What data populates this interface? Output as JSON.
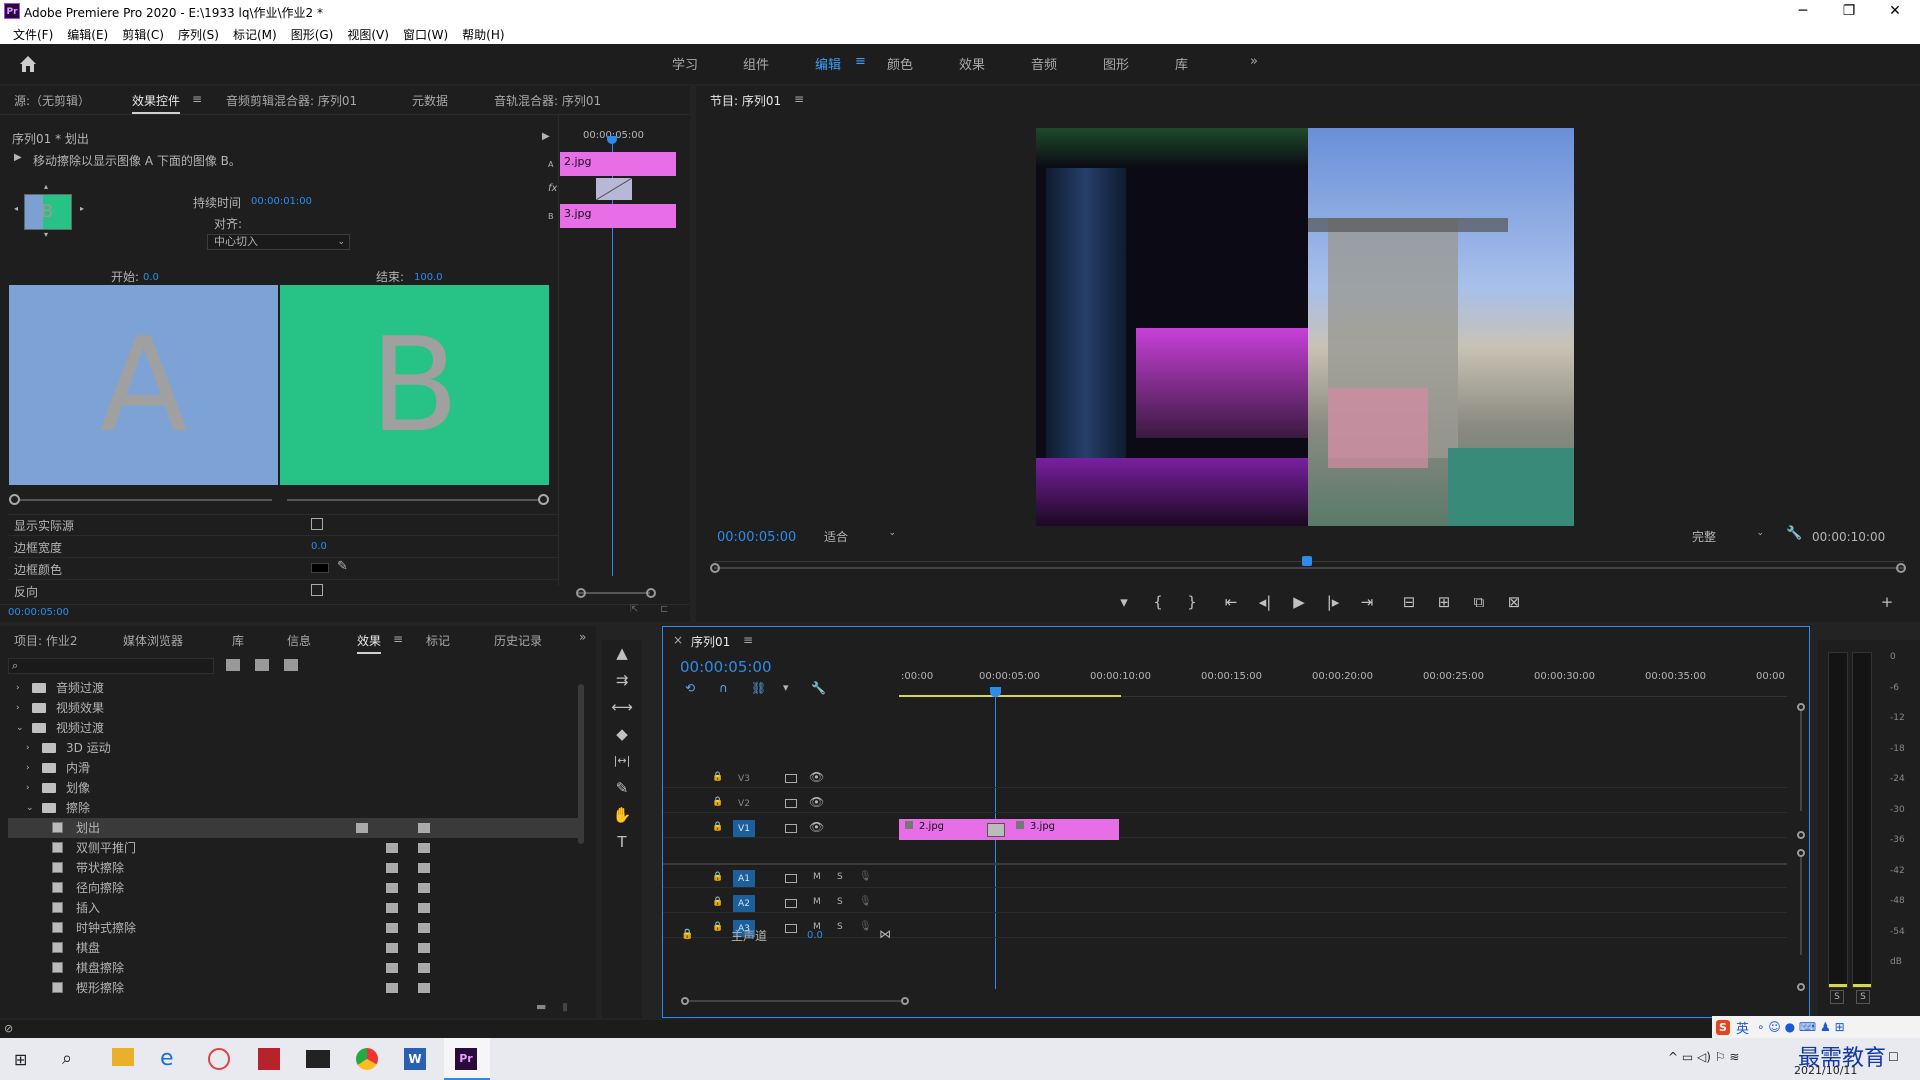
{
  "window": {
    "title": "Adobe Premiere Pro 2020 - E:\\1933 lq\\作业\\作业2 *",
    "app_icon": "Pr",
    "minimize": "─",
    "restore": "❐",
    "close": "✕"
  },
  "menu": [
    "文件(F)",
    "编辑(E)",
    "剪辑(C)",
    "序列(S)",
    "标记(M)",
    "图形(G)",
    "视图(V)",
    "窗口(W)",
    "帮助(H)"
  ],
  "workspaces": {
    "items": [
      "学习",
      "组件",
      "编辑",
      "颜色",
      "效果",
      "音频",
      "图形",
      "库"
    ],
    "active": "编辑",
    "more": "»",
    "menu_icon": "≡"
  },
  "source_panel": {
    "tabs": [
      "源:（无剪辑）",
      "效果控件",
      "音频剪辑混合器: 序列01",
      "元数据",
      "音轨混合器: 序列01"
    ],
    "active_menu": "≡"
  },
  "effect_controls": {
    "clip": "序列01 * 划出",
    "desc": "移动擦除以显示图像 A 下面的图像 B。",
    "duration_label": "持续时间",
    "duration": "00:00:01:00",
    "align_label": "对齐:",
    "align": "中心切入",
    "start_label": "开始:",
    "start": "0.0",
    "end_label": "结束:",
    "end": "100.0",
    "a": "A",
    "b": "B",
    "thumb": "B",
    "show_actual": "显示实际源",
    "border_width_label": "边框宽度",
    "border_width": "0.0",
    "border_color_label": "边框颜色",
    "reverse_label": "反向",
    "ruler_time": "00:00:05:00",
    "clip_a": "2.jpg",
    "clip_b": "3.jpg",
    "track_a": "A",
    "track_b": "B",
    "fx": "fx",
    "bottom_time": "00:00:05:00"
  },
  "program": {
    "title": "节目: 序列01",
    "menu": "≡",
    "timecode": "00:00:05:00",
    "fit": "适合",
    "quality": "完整",
    "duration": "00:00:10:00",
    "add": "+",
    "transport": [
      "▾",
      "{",
      "}",
      "⇤",
      "◂|",
      "▶",
      "|▸",
      "⇥",
      "⊟",
      "⊞",
      "⧉",
      "⊠"
    ]
  },
  "project": {
    "tabs": [
      "项目: 作业2",
      "媒体浏览器",
      "库",
      "信息",
      "效果",
      "标记",
      "历史记录"
    ],
    "active": "效果",
    "more": "»",
    "search_placeholder": "",
    "tree": [
      {
        "label": "音频过渡",
        "level": 0,
        "open": false
      },
      {
        "label": "视频效果",
        "level": 0,
        "open": false
      },
      {
        "label": "视频过渡",
        "level": 0,
        "open": true
      },
      {
        "label": "3D 运动",
        "level": 1,
        "open": false
      },
      {
        "label": "内滑",
        "level": 1,
        "open": false
      },
      {
        "label": "划像",
        "level": 1,
        "open": false
      },
      {
        "label": "擦除",
        "level": 1,
        "open": true
      },
      {
        "label": "划出",
        "level": 2,
        "fx": true,
        "sel": true
      },
      {
        "label": "双侧平推门",
        "level": 2,
        "fx": true
      },
      {
        "label": "带状擦除",
        "level": 2,
        "fx": true
      },
      {
        "label": "径向擦除",
        "level": 2,
        "fx": true
      },
      {
        "label": "插入",
        "level": 2,
        "fx": true
      },
      {
        "label": "时钟式擦除",
        "level": 2,
        "fx": true
      },
      {
        "label": "棋盘",
        "level": 2,
        "fx": true
      },
      {
        "label": "棋盘擦除",
        "level": 2,
        "fx": true
      },
      {
        "label": "楔形擦除",
        "level": 2,
        "fx": true
      }
    ]
  },
  "tools": [
    "▲",
    "⇉",
    "⟷",
    "◆",
    "|↔|",
    "✎",
    "✋",
    "T"
  ],
  "timeline": {
    "close": "×",
    "title": "序列01",
    "menu": "≡",
    "timecode": "00:00:05:00",
    "ruler": [
      ":00:00",
      "00:00:05:00",
      "00:00:10:00",
      "00:00:15:00",
      "00:00:20:00",
      "00:00:25:00",
      "00:00:30:00",
      "00:00:35:00",
      "00:00"
    ],
    "tracks": [
      {
        "id": "V3",
        "type": "v"
      },
      {
        "id": "V2",
        "type": "v"
      },
      {
        "id": "V1",
        "type": "v",
        "target": true
      },
      {
        "id": "A1",
        "type": "a",
        "target": true
      },
      {
        "id": "A2",
        "type": "a",
        "target": true
      },
      {
        "id": "A3",
        "type": "a",
        "target": true
      }
    ],
    "m": "M",
    "s": "S",
    "master_label": "主声道",
    "master_value": "0.0",
    "clip1": "2.jpg",
    "clip2": "3.jpg"
  },
  "meter": {
    "ticks": [
      "0",
      "-6",
      "-12",
      "-18",
      "-24",
      "-30",
      "-36",
      "-42",
      "-48",
      "-54",
      "dB"
    ],
    "s1": "S",
    "s2": "S"
  },
  "taskbar": {
    "date": "2021/10/11",
    "ime": "英",
    "watermark": "最需教育"
  }
}
